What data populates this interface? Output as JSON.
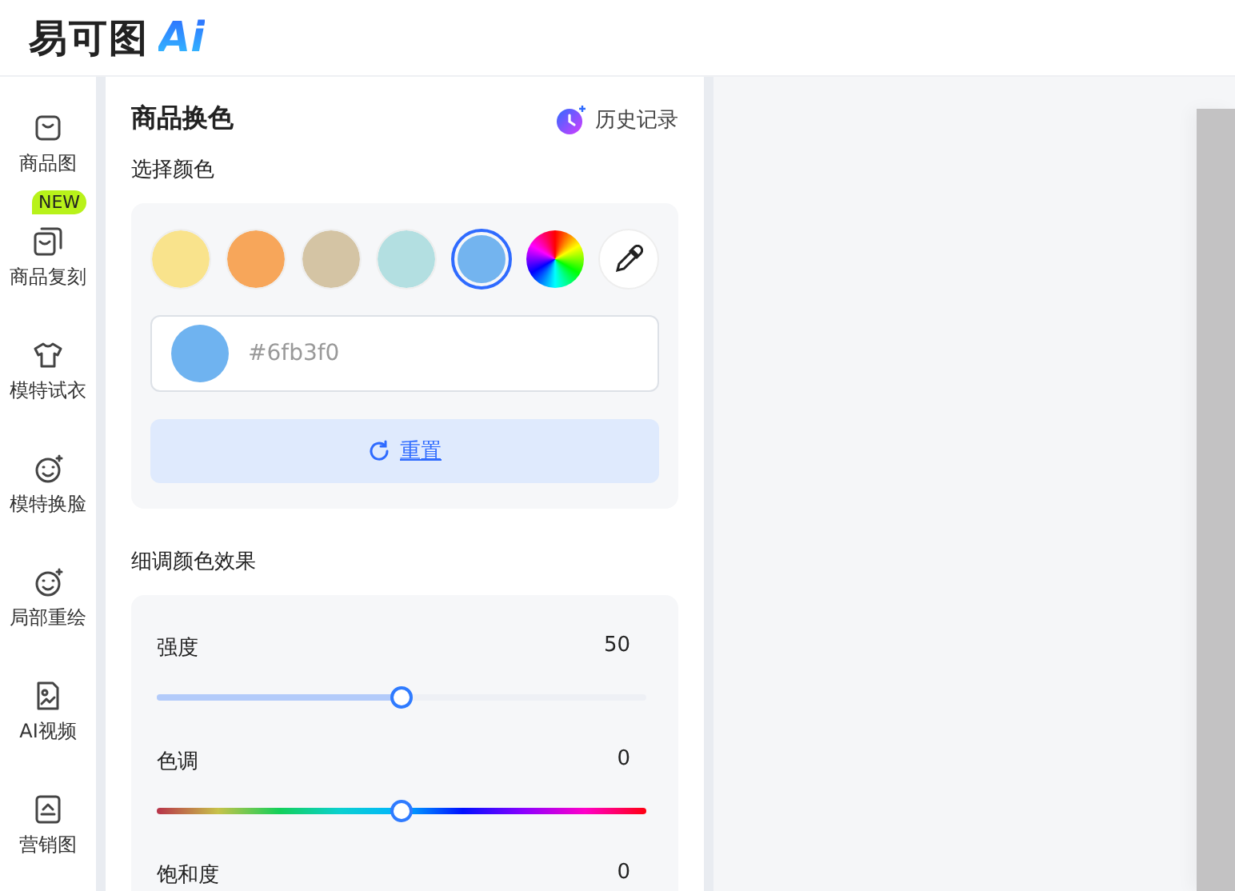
{
  "header": {
    "logo_text": "易可图",
    "logo_mark": "Ai"
  },
  "nav": {
    "items": [
      {
        "label": "商品图",
        "selected": false
      },
      {
        "label": "商品复刻",
        "badge": "NEW",
        "selected": false
      },
      {
        "label": "模特试衣",
        "selected": false
      },
      {
        "label": "模特换脸",
        "selected": false
      },
      {
        "label": "局部重绘",
        "selected": false
      },
      {
        "label": "AI视频",
        "selected": false
      },
      {
        "label": "营销图",
        "selected": false
      }
    ]
  },
  "panel": {
    "title": "商品换色",
    "history_link": "历史记录",
    "color_section": {
      "label": "选择颜色",
      "swatches": [
        {
          "kind": "swatch",
          "color": "#f9e38c",
          "selected": false
        },
        {
          "kind": "swatch",
          "color": "#f7a65a",
          "selected": false
        },
        {
          "kind": "swatch",
          "color": "#d4c4a4",
          "selected": false
        },
        {
          "kind": "swatch",
          "color": "#b3dfe1",
          "selected": false
        },
        {
          "kind": "swatch",
          "color": "#73b4ef",
          "selected": true
        },
        {
          "kind": "wheel",
          "selected": false
        },
        {
          "kind": "eyedropper",
          "selected": false
        }
      ],
      "hex_value": "#6fb3f0",
      "reset_button": "重置"
    },
    "fine_tune": {
      "label": "细调颜色效果",
      "sliders": [
        {
          "kind": "plain",
          "label": "强度",
          "reading": "50",
          "level": 0.5
        },
        {
          "kind": "hue",
          "label": "色调",
          "reading": "0",
          "level": 0.5
        },
        {
          "label": "饱和度",
          "reading": "0"
        }
      ]
    }
  }
}
